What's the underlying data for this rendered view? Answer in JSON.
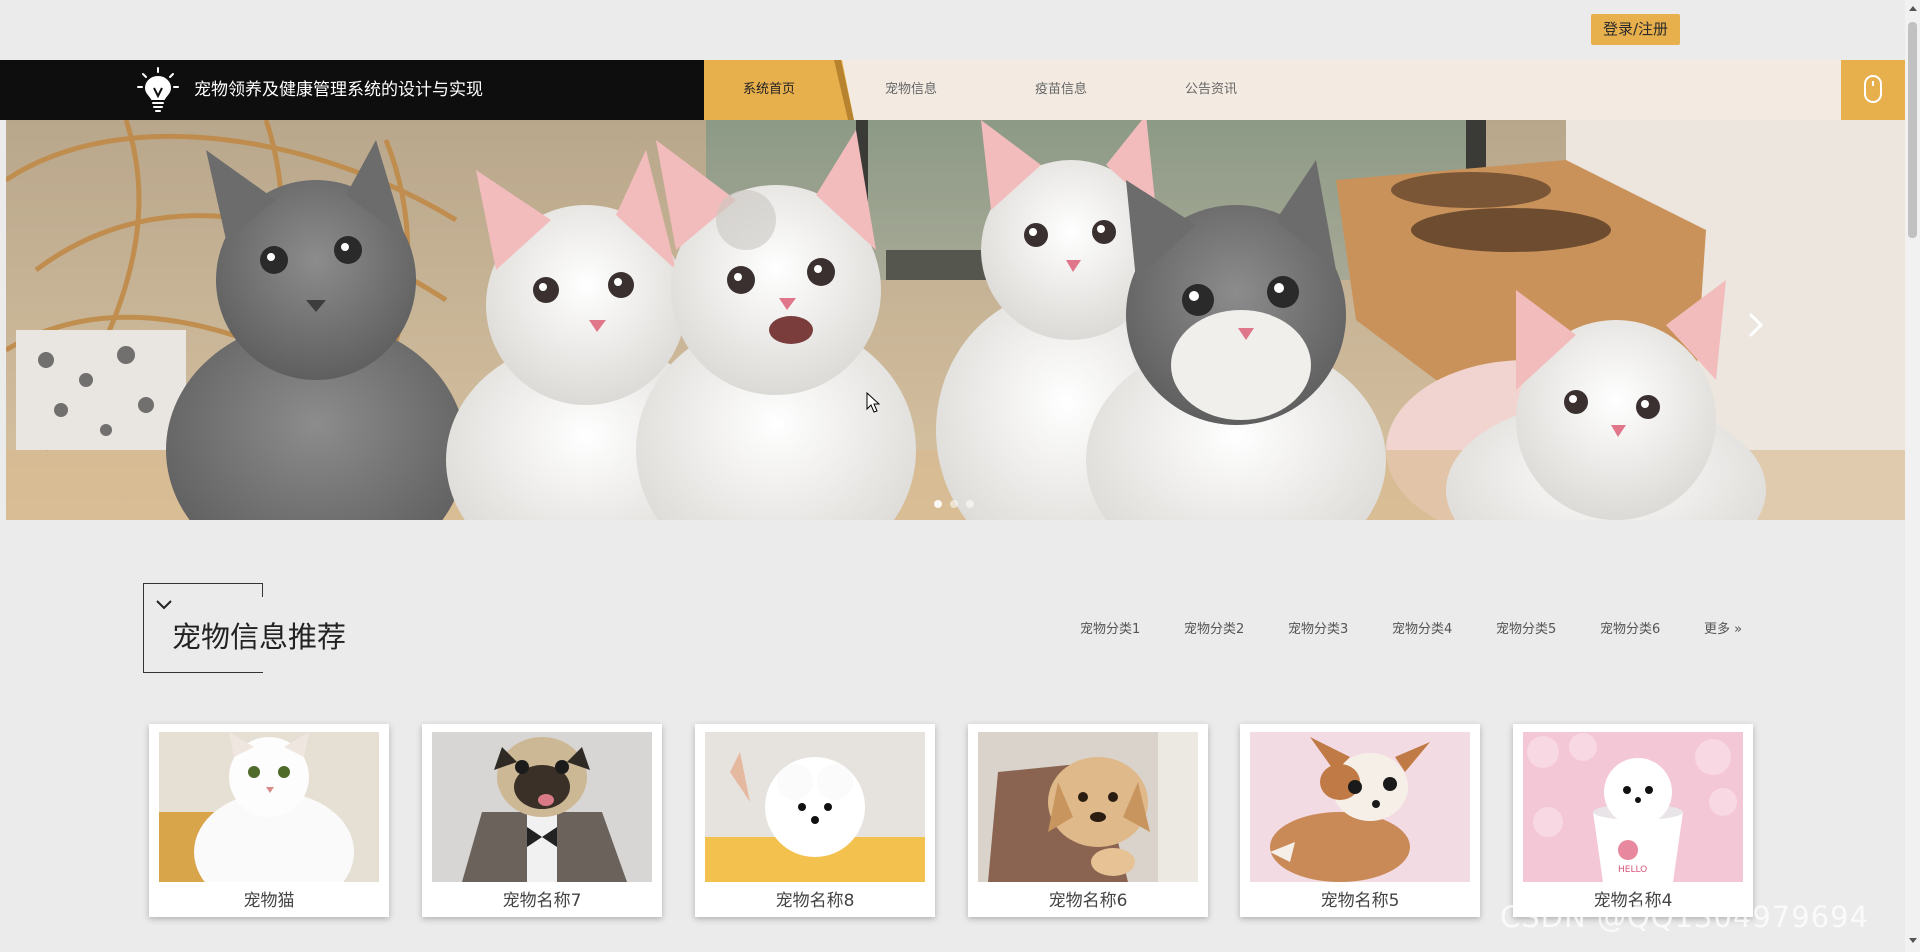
{
  "header": {
    "login_label": "登录/注册",
    "brand_title": "宠物领养及健康管理系统的设计与实现",
    "nav": [
      {
        "label": "系统首页",
        "active": true
      },
      {
        "label": "宠物信息",
        "active": false
      },
      {
        "label": "疫苗信息",
        "active": false
      },
      {
        "label": "公告资讯",
        "active": false
      }
    ]
  },
  "banner": {
    "dots": 3,
    "active_dot": 0
  },
  "section": {
    "title": "宠物信息推荐",
    "categories": [
      "宠物分类1",
      "宠物分类2",
      "宠物分类3",
      "宠物分类4",
      "宠物分类5",
      "宠物分类6"
    ],
    "more_label": "更多 »"
  },
  "cards": [
    {
      "name": "宠物猫",
      "icon": "white-cat-photo"
    },
    {
      "name": "宠物名称7",
      "icon": "pug-photo"
    },
    {
      "name": "宠物名称8",
      "icon": "white-pomeranian-photo"
    },
    {
      "name": "宠物名称6",
      "icon": "golden-puppy-photo"
    },
    {
      "name": "宠物名称5",
      "icon": "chihuahua-photo"
    },
    {
      "name": "宠物名称4",
      "icon": "teacup-pomeranian-photo"
    }
  ],
  "watermark": "CSDN @QQ1304979694",
  "colors": {
    "accent": "#e8b04d",
    "brand_bg": "#0e0e0e",
    "nav_bg": "#f3ebe2",
    "page_bg": "#ebebeb"
  }
}
